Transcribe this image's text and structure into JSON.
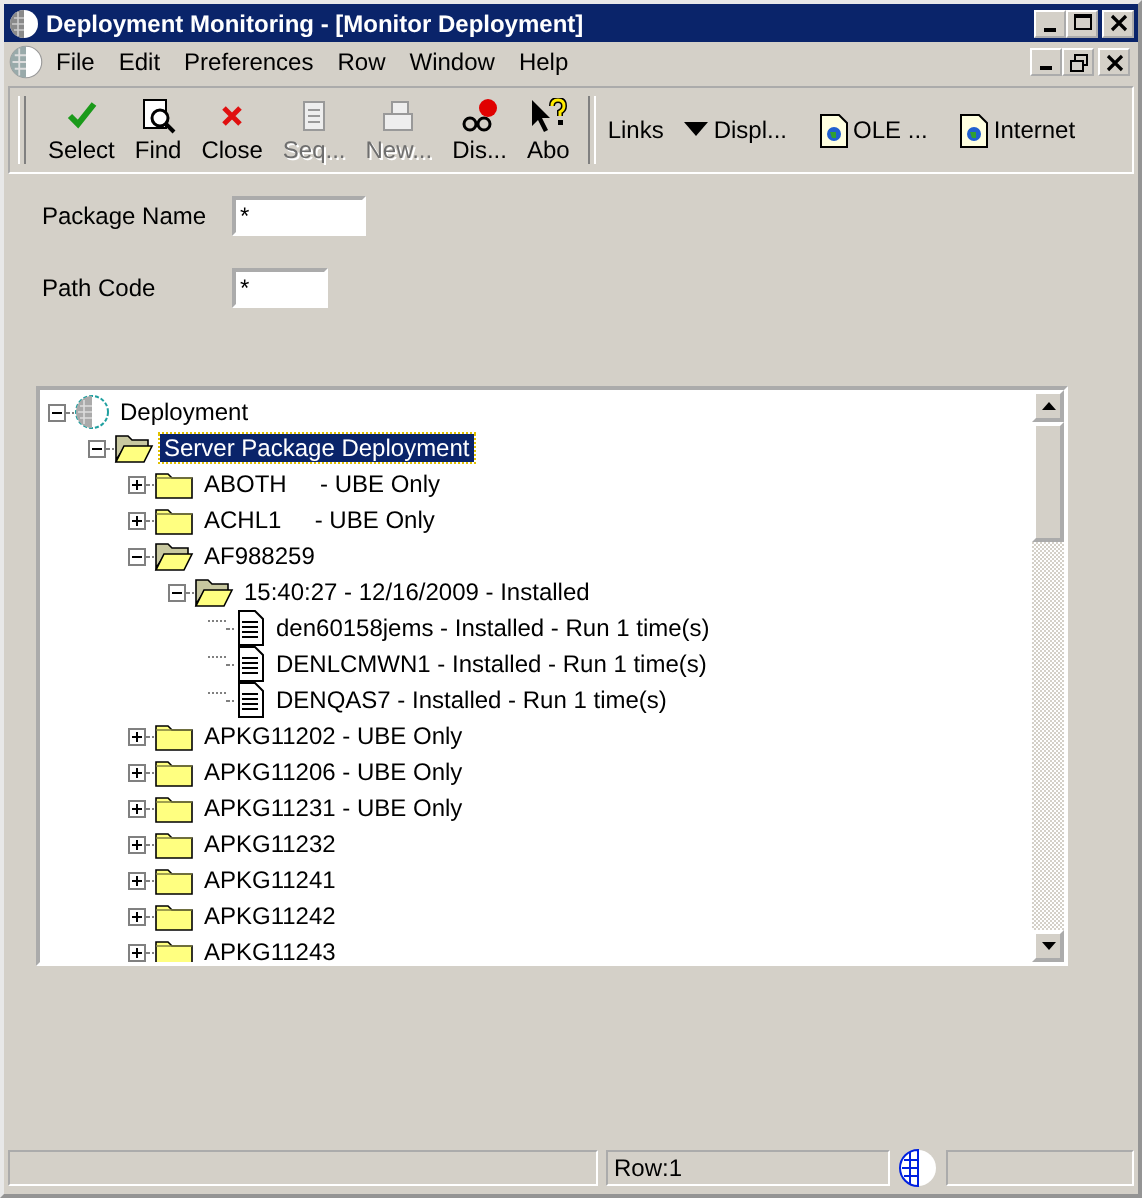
{
  "window": {
    "title": "Deployment Monitoring - [Monitor Deployment]"
  },
  "menu": [
    "File",
    "Edit",
    "Preferences",
    "Row",
    "Window",
    "Help"
  ],
  "toolbar": [
    {
      "label": "Select",
      "kind": "check",
      "disabled": false
    },
    {
      "label": "Find",
      "kind": "find",
      "disabled": false
    },
    {
      "label": "Close",
      "kind": "close",
      "disabled": false
    },
    {
      "label": "Seq...",
      "kind": "seq",
      "disabled": true
    },
    {
      "label": "New...",
      "kind": "new",
      "disabled": true
    },
    {
      "label": "Dis...",
      "kind": "display",
      "disabled": false
    },
    {
      "label": "Abo",
      "kind": "about",
      "disabled": false
    }
  ],
  "links": [
    {
      "label": "Links",
      "kind": "text"
    },
    {
      "label": "Displ...",
      "kind": "dropdown"
    },
    {
      "label": "OLE ...",
      "kind": "doc"
    },
    {
      "label": "Internet",
      "kind": "doc"
    }
  ],
  "fields": [
    {
      "label": "Package Name",
      "value": "*"
    },
    {
      "label": "Path Code",
      "value": "*"
    }
  ],
  "tree": [
    {
      "label": "Deployment",
      "kind": "globe",
      "expanded": true,
      "selected": false,
      "children": [
        {
          "label": "Server Package Deployment",
          "kind": "folder",
          "expanded": true,
          "selected": true,
          "children": [
            {
              "label": "ABOTH     - UBE Only",
              "kind": "folder",
              "expanded": false,
              "selected": false
            },
            {
              "label": "ACHL1     - UBE Only",
              "kind": "folder",
              "expanded": false,
              "selected": false
            },
            {
              "label": "AF988259",
              "kind": "folder",
              "expanded": true,
              "selected": false,
              "children": [
                {
                  "label": "15:40:27 - 12/16/2009 - Installed",
                  "kind": "folder",
                  "expanded": true,
                  "selected": false,
                  "children": [
                    {
                      "label": "den60158jems - Installed - Run 1 time(s)",
                      "kind": "doc",
                      "selected": false
                    },
                    {
                      "label": "DENLCMWN1 - Installed - Run 1 time(s)",
                      "kind": "doc",
                      "selected": false
                    },
                    {
                      "label": "DENQAS7 - Installed - Run 1 time(s)",
                      "kind": "doc",
                      "selected": false
                    }
                  ]
                }
              ]
            },
            {
              "label": "APKG11202 - UBE Only",
              "kind": "folder",
              "expanded": false,
              "selected": false
            },
            {
              "label": "APKG11206 - UBE Only",
              "kind": "folder",
              "expanded": false,
              "selected": false
            },
            {
              "label": "APKG11231 - UBE Only",
              "kind": "folder",
              "expanded": false,
              "selected": false
            },
            {
              "label": "APKG11232",
              "kind": "folder",
              "expanded": false,
              "selected": false
            },
            {
              "label": "APKG11241",
              "kind": "folder",
              "expanded": false,
              "selected": false
            },
            {
              "label": "APKG11242",
              "kind": "folder",
              "expanded": false,
              "selected": false
            },
            {
              "label": "APKG11243",
              "kind": "folder",
              "expanded": false,
              "selected": false
            }
          ]
        }
      ]
    }
  ],
  "status_bar": {
    "row": "Row:1"
  }
}
